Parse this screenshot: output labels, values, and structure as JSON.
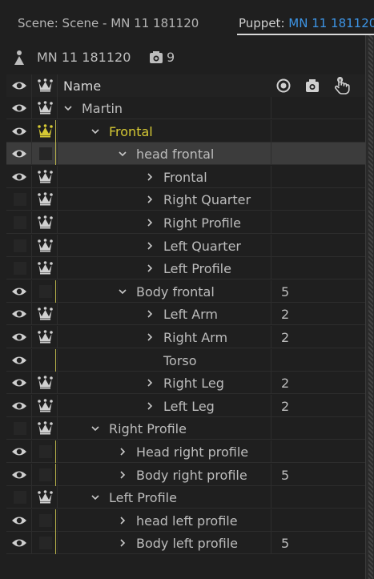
{
  "tabs": {
    "scene": "Scene: Scene - MN 11 181120",
    "puppet_prefix": "Puppet: ",
    "puppet_value": "MN 11 181120"
  },
  "puppet": {
    "name": "MN 11 181120",
    "count": "9"
  },
  "header": {
    "name_label": "Name",
    "icons": [
      "target-icon",
      "camera-icon",
      "hand-icon"
    ]
  },
  "rows": [
    {
      "label": "Martin",
      "depth": 0,
      "chevron": "down",
      "eye": true,
      "crown": "on",
      "num": ""
    },
    {
      "label": "Frontal",
      "depth": 1,
      "chevron": "down",
      "eye": true,
      "crown": "gold",
      "num": ""
    },
    {
      "label": "head frontal",
      "depth": 2,
      "chevron": "down",
      "eye": true,
      "crown": "off",
      "num": "",
      "selected": true
    },
    {
      "label": "Frontal",
      "depth": 3,
      "chevron": "right",
      "eye": true,
      "crown": "on",
      "num": ""
    },
    {
      "label": "Right Quarter",
      "depth": 3,
      "chevron": "right",
      "eye": false,
      "crown": "on",
      "num": ""
    },
    {
      "label": "Right Profile",
      "depth": 3,
      "chevron": "right",
      "eye": false,
      "crown": "on",
      "num": ""
    },
    {
      "label": "Left Quarter",
      "depth": 3,
      "chevron": "right",
      "eye": false,
      "crown": "on",
      "num": ""
    },
    {
      "label": "Left Profile",
      "depth": 3,
      "chevron": "right",
      "eye": false,
      "crown": "on",
      "num": ""
    },
    {
      "label": "Body frontal",
      "depth": 2,
      "chevron": "down",
      "eye": true,
      "crown": "off",
      "num": "5"
    },
    {
      "label": "Left Arm",
      "depth": 3,
      "chevron": "right",
      "eye": true,
      "crown": "on",
      "num": "2"
    },
    {
      "label": "Right Arm",
      "depth": 3,
      "chevron": "right",
      "eye": true,
      "crown": "on",
      "num": "2"
    },
    {
      "label": "Torso",
      "depth": 3,
      "chevron": "none",
      "eye": true,
      "crown": "none",
      "num": ""
    },
    {
      "label": "Right Leg",
      "depth": 3,
      "chevron": "right",
      "eye": true,
      "crown": "on",
      "num": "2"
    },
    {
      "label": "Left Leg",
      "depth": 3,
      "chevron": "right",
      "eye": true,
      "crown": "on",
      "num": "2"
    },
    {
      "label": "Right Profile",
      "depth": 1,
      "chevron": "down",
      "eye": false,
      "crown": "on",
      "num": ""
    },
    {
      "label": "Head right profile",
      "depth": 2,
      "chevron": "right",
      "eye": true,
      "crown": "off",
      "num": ""
    },
    {
      "label": "Body right profile",
      "depth": 2,
      "chevron": "right",
      "eye": true,
      "crown": "off",
      "num": "5"
    },
    {
      "label": "Left Profile",
      "depth": 1,
      "chevron": "down",
      "eye": false,
      "crown": "on",
      "num": ""
    },
    {
      "label": "head left profile",
      "depth": 2,
      "chevron": "right",
      "eye": true,
      "crown": "off",
      "num": ""
    },
    {
      "label": "Body left profile",
      "depth": 2,
      "chevron": "right",
      "eye": true,
      "crown": "off",
      "num": "5"
    }
  ],
  "colors": {
    "accent_blue": "#3d95e6",
    "gold": "#d6c934",
    "text": "#bdbdbd",
    "background": "#1f1f1f",
    "selected_row": "#3c3c3c"
  }
}
